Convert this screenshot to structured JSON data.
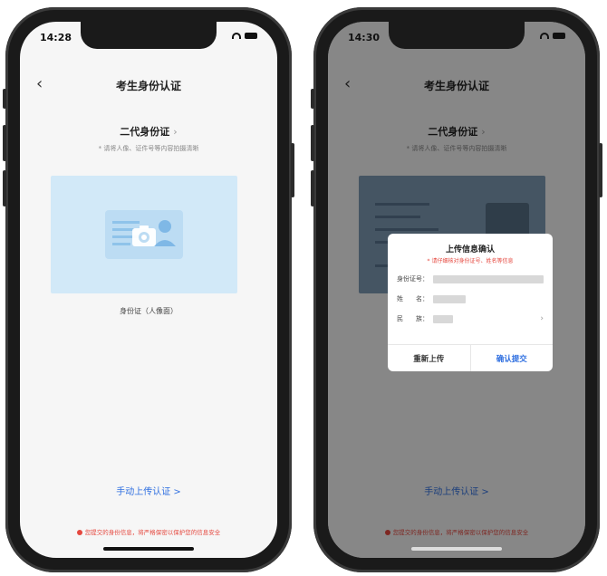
{
  "left_screen": {
    "status": {
      "time": "14:28"
    },
    "nav": {
      "title": "考生身份认证"
    },
    "id_type": {
      "label": "二代身份证",
      "chevron": "›"
    },
    "hint": "* 请将人像、证件号等内容拍摄清晰",
    "card_caption": "身份证（人像面）",
    "manual_link": "手动上传认证 >",
    "privacy_note": "您提交的身份信息，将严格保密以保护您的信息安全"
  },
  "right_screen": {
    "status": {
      "time": "14:30"
    },
    "nav": {
      "title": "考生身份认证"
    },
    "id_type": {
      "label": "二代身份证",
      "chevron": "›"
    },
    "hint": "* 请将人像、证件号等内容拍摄清晰",
    "manual_link": "手动上传认证 >",
    "privacy_note": "您提交的身份信息，将严格保密以保护您的信息安全",
    "modal": {
      "title": "上传信息确认",
      "warning": "* 请仔细核对身份证号、姓名等信息",
      "fields": [
        {
          "label": "身份证号：",
          "chevron": ""
        },
        {
          "label": "姓　　名：",
          "chevron": ""
        },
        {
          "label": "民　　族：",
          "chevron": "›"
        }
      ],
      "buttons": {
        "reupload": "重新上传",
        "confirm": "确认提交"
      }
    }
  },
  "colors": {
    "accent": "#2f6fe0",
    "warning": "#e5483f",
    "card_bg": "#d2e9f8"
  }
}
